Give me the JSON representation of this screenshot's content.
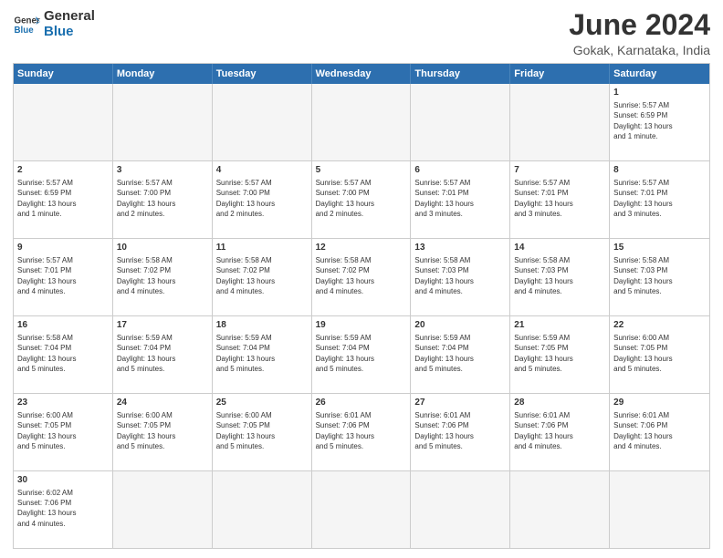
{
  "header": {
    "logo_general": "General",
    "logo_blue": "Blue",
    "title": "June 2024",
    "subtitle": "Gokak, Karnataka, India"
  },
  "days_of_week": [
    "Sunday",
    "Monday",
    "Tuesday",
    "Wednesday",
    "Thursday",
    "Friday",
    "Saturday"
  ],
  "rows": [
    {
      "cells": [
        {
          "day": "",
          "empty": true
        },
        {
          "day": "",
          "empty": true
        },
        {
          "day": "",
          "empty": true
        },
        {
          "day": "",
          "empty": true
        },
        {
          "day": "",
          "empty": true
        },
        {
          "day": "",
          "empty": true
        },
        {
          "day": "1",
          "info": "Sunrise: 5:57 AM\nSunset: 6:59 PM\nDaylight: 13 hours\nand 1 minute."
        }
      ]
    },
    {
      "cells": [
        {
          "day": "2",
          "info": "Sunrise: 5:57 AM\nSunset: 6:59 PM\nDaylight: 13 hours\nand 1 minute."
        },
        {
          "day": "3",
          "info": "Sunrise: 5:57 AM\nSunset: 7:00 PM\nDaylight: 13 hours\nand 2 minutes."
        },
        {
          "day": "4",
          "info": "Sunrise: 5:57 AM\nSunset: 7:00 PM\nDaylight: 13 hours\nand 2 minutes."
        },
        {
          "day": "5",
          "info": "Sunrise: 5:57 AM\nSunset: 7:00 PM\nDaylight: 13 hours\nand 2 minutes."
        },
        {
          "day": "6",
          "info": "Sunrise: 5:57 AM\nSunset: 7:01 PM\nDaylight: 13 hours\nand 3 minutes."
        },
        {
          "day": "7",
          "info": "Sunrise: 5:57 AM\nSunset: 7:01 PM\nDaylight: 13 hours\nand 3 minutes."
        },
        {
          "day": "8",
          "info": "Sunrise: 5:57 AM\nSunset: 7:01 PM\nDaylight: 13 hours\nand 3 minutes."
        }
      ]
    },
    {
      "cells": [
        {
          "day": "9",
          "info": "Sunrise: 5:57 AM\nSunset: 7:01 PM\nDaylight: 13 hours\nand 4 minutes."
        },
        {
          "day": "10",
          "info": "Sunrise: 5:58 AM\nSunset: 7:02 PM\nDaylight: 13 hours\nand 4 minutes."
        },
        {
          "day": "11",
          "info": "Sunrise: 5:58 AM\nSunset: 7:02 PM\nDaylight: 13 hours\nand 4 minutes."
        },
        {
          "day": "12",
          "info": "Sunrise: 5:58 AM\nSunset: 7:02 PM\nDaylight: 13 hours\nand 4 minutes."
        },
        {
          "day": "13",
          "info": "Sunrise: 5:58 AM\nSunset: 7:03 PM\nDaylight: 13 hours\nand 4 minutes."
        },
        {
          "day": "14",
          "info": "Sunrise: 5:58 AM\nSunset: 7:03 PM\nDaylight: 13 hours\nand 4 minutes."
        },
        {
          "day": "15",
          "info": "Sunrise: 5:58 AM\nSunset: 7:03 PM\nDaylight: 13 hours\nand 5 minutes."
        }
      ]
    },
    {
      "cells": [
        {
          "day": "16",
          "info": "Sunrise: 5:58 AM\nSunset: 7:04 PM\nDaylight: 13 hours\nand 5 minutes."
        },
        {
          "day": "17",
          "info": "Sunrise: 5:59 AM\nSunset: 7:04 PM\nDaylight: 13 hours\nand 5 minutes."
        },
        {
          "day": "18",
          "info": "Sunrise: 5:59 AM\nSunset: 7:04 PM\nDaylight: 13 hours\nand 5 minutes."
        },
        {
          "day": "19",
          "info": "Sunrise: 5:59 AM\nSunset: 7:04 PM\nDaylight: 13 hours\nand 5 minutes."
        },
        {
          "day": "20",
          "info": "Sunrise: 5:59 AM\nSunset: 7:04 PM\nDaylight: 13 hours\nand 5 minutes."
        },
        {
          "day": "21",
          "info": "Sunrise: 5:59 AM\nSunset: 7:05 PM\nDaylight: 13 hours\nand 5 minutes."
        },
        {
          "day": "22",
          "info": "Sunrise: 6:00 AM\nSunset: 7:05 PM\nDaylight: 13 hours\nand 5 minutes."
        }
      ]
    },
    {
      "cells": [
        {
          "day": "23",
          "info": "Sunrise: 6:00 AM\nSunset: 7:05 PM\nDaylight: 13 hours\nand 5 minutes."
        },
        {
          "day": "24",
          "info": "Sunrise: 6:00 AM\nSunset: 7:05 PM\nDaylight: 13 hours\nand 5 minutes."
        },
        {
          "day": "25",
          "info": "Sunrise: 6:00 AM\nSunset: 7:05 PM\nDaylight: 13 hours\nand 5 minutes."
        },
        {
          "day": "26",
          "info": "Sunrise: 6:01 AM\nSunset: 7:06 PM\nDaylight: 13 hours\nand 5 minutes."
        },
        {
          "day": "27",
          "info": "Sunrise: 6:01 AM\nSunset: 7:06 PM\nDaylight: 13 hours\nand 5 minutes."
        },
        {
          "day": "28",
          "info": "Sunrise: 6:01 AM\nSunset: 7:06 PM\nDaylight: 13 hours\nand 4 minutes."
        },
        {
          "day": "29",
          "info": "Sunrise: 6:01 AM\nSunset: 7:06 PM\nDaylight: 13 hours\nand 4 minutes."
        }
      ]
    },
    {
      "cells": [
        {
          "day": "30",
          "info": "Sunrise: 6:02 AM\nSunset: 7:06 PM\nDaylight: 13 hours\nand 4 minutes."
        },
        {
          "day": "",
          "empty": true
        },
        {
          "day": "",
          "empty": true
        },
        {
          "day": "",
          "empty": true
        },
        {
          "day": "",
          "empty": true
        },
        {
          "day": "",
          "empty": true
        },
        {
          "day": "",
          "empty": true
        }
      ]
    }
  ]
}
